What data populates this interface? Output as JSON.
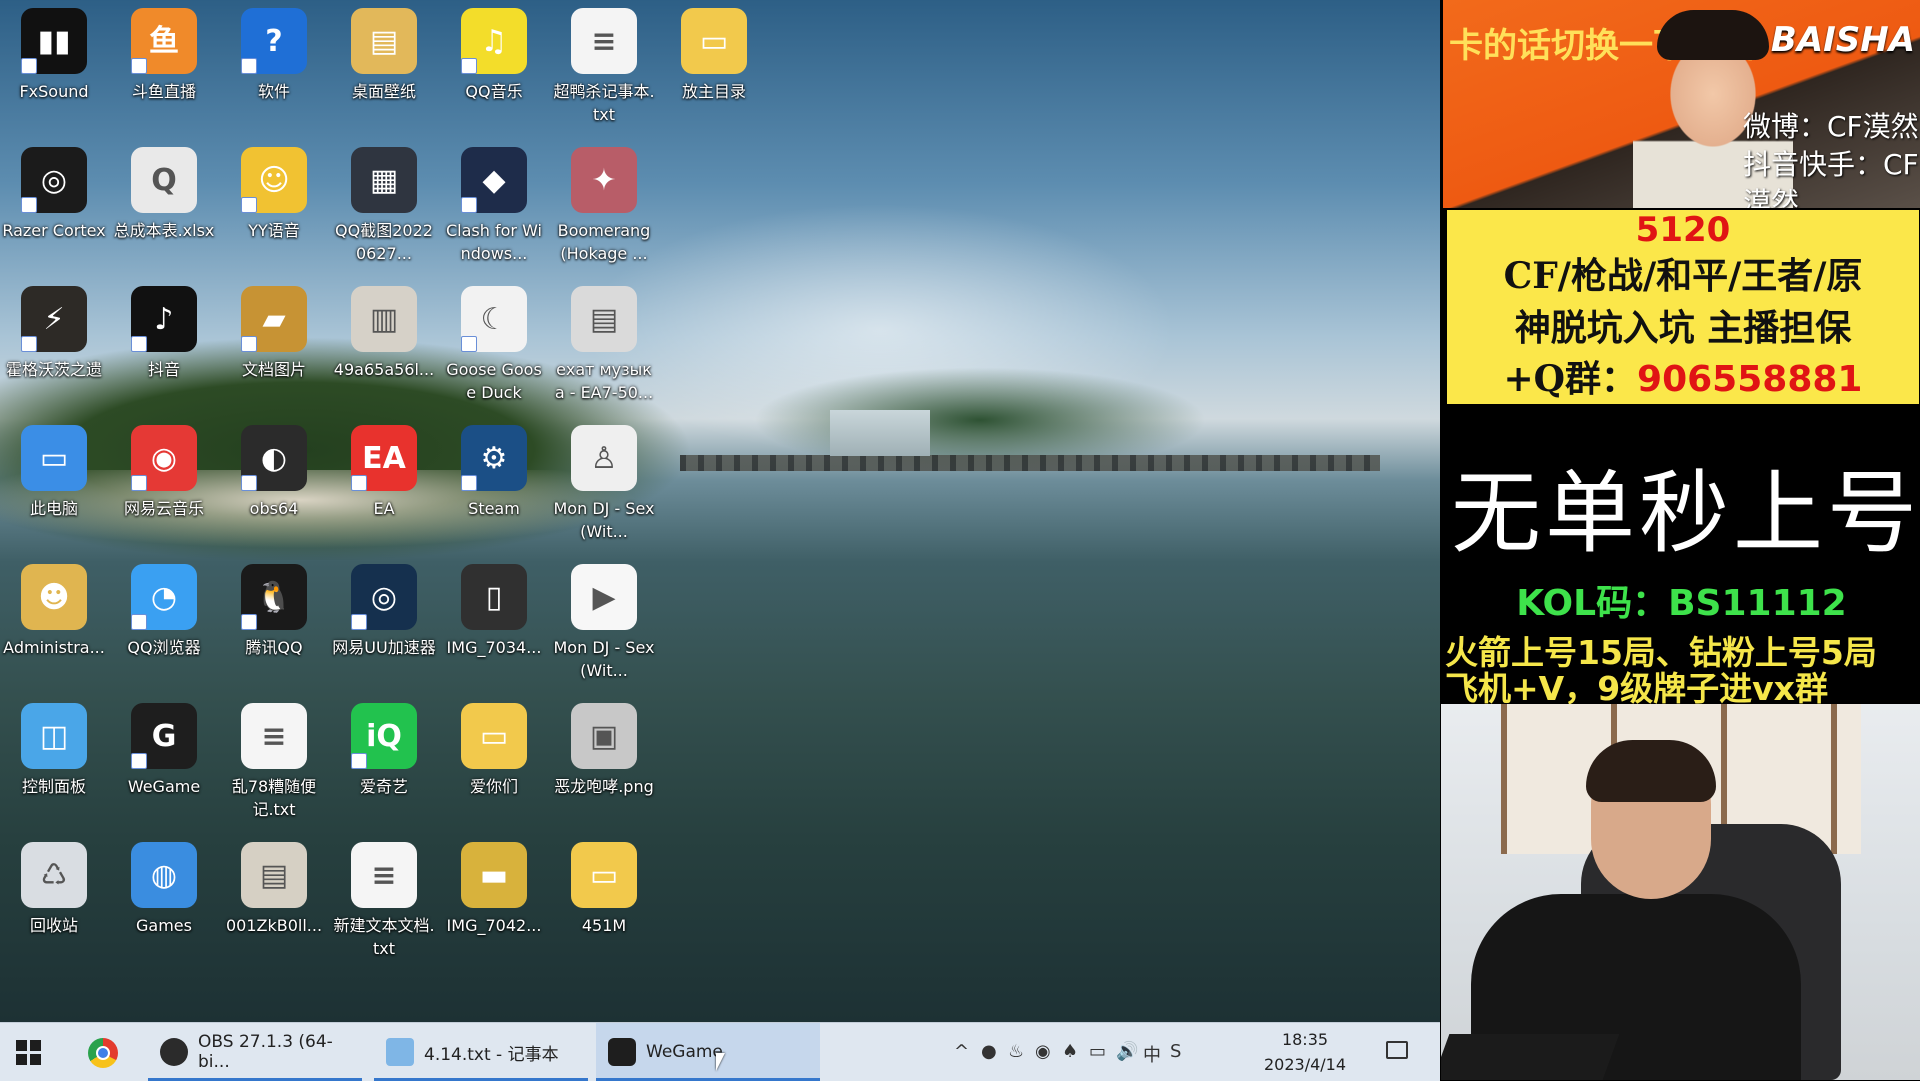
{
  "desktop": {
    "icons": [
      {
        "label": "FxSound",
        "color": "#111111",
        "glyph": "▮▮",
        "shortcut": true,
        "col": 0,
        "row": 0
      },
      {
        "label": "斗鱼直播",
        "color": "#f08a2a",
        "glyph": "鱼",
        "shortcut": true,
        "col": 1,
        "row": 0
      },
      {
        "label": "软件",
        "color": "#1f6fd6",
        "glyph": "?",
        "shortcut": true,
        "col": 2,
        "row": 0
      },
      {
        "label": "桌面壁纸",
        "color": "#e2b85a",
        "glyph": "▤",
        "shortcut": false,
        "col": 3,
        "row": 0
      },
      {
        "label": "QQ音乐",
        "color": "#f3dd2a",
        "glyph": "♫",
        "shortcut": true,
        "col": 4,
        "row": 0
      },
      {
        "label": "超鸭杀记事本.txt",
        "color": "#f4f4f4",
        "glyph": "≡",
        "shortcut": false,
        "col": 5,
        "row": 0
      },
      {
        "label": "放主目录",
        "color": "#f2c94c",
        "glyph": "▭",
        "shortcut": false,
        "col": 6,
        "row": 0
      },
      {
        "label": "Razer Cortex",
        "color": "#1b1b1b",
        "glyph": "◎",
        "shortcut": true,
        "col": 0,
        "row": 1
      },
      {
        "label": "总成本表.xlsx",
        "color": "#e9e9e9",
        "glyph": "Q",
        "shortcut": false,
        "col": 1,
        "row": 1
      },
      {
        "label": "YY语音",
        "color": "#f1c232",
        "glyph": "☺",
        "shortcut": true,
        "col": 2,
        "row": 1
      },
      {
        "label": "QQ截图20220627...",
        "color": "#2f3540",
        "glyph": "▦",
        "shortcut": false,
        "col": 3,
        "row": 1
      },
      {
        "label": "Clash for Windows...",
        "color": "#1e2c4a",
        "glyph": "◆",
        "shortcut": true,
        "col": 4,
        "row": 1
      },
      {
        "label": "Boomerang (Hokage ...",
        "color": "#b85d68",
        "glyph": "✦",
        "shortcut": false,
        "col": 5,
        "row": 1
      },
      {
        "label": "霍格沃茨之遗",
        "color": "#2d2a26",
        "glyph": "⚡",
        "shortcut": true,
        "col": 0,
        "row": 2
      },
      {
        "label": "抖音",
        "color": "#111111",
        "glyph": "♪",
        "shortcut": true,
        "col": 1,
        "row": 2
      },
      {
        "label": "文档图片",
        "color": "#c79334",
        "glyph": "▰",
        "shortcut": true,
        "col": 2,
        "row": 2
      },
      {
        "label": "49a65a56l...",
        "color": "#d6d1c8",
        "glyph": "▥",
        "shortcut": false,
        "col": 3,
        "row": 2
      },
      {
        "label": "Goose Goose Duck",
        "color": "#f2f2f2",
        "glyph": "☾",
        "shortcut": true,
        "col": 4,
        "row": 2
      },
      {
        "label": "ехат музык а - EA7-50...",
        "color": "#dadada",
        "glyph": "▤",
        "shortcut": false,
        "col": 5,
        "row": 2
      },
      {
        "label": "此电脑",
        "color": "#3b8ee6",
        "glyph": "▭",
        "shortcut": false,
        "col": 0,
        "row": 3
      },
      {
        "label": "网易云音乐",
        "color": "#e53935",
        "glyph": "◉",
        "shortcut": true,
        "col": 1,
        "row": 3
      },
      {
        "label": "obs64",
        "color": "#2b2b2b",
        "glyph": "◐",
        "shortcut": true,
        "col": 2,
        "row": 3
      },
      {
        "label": "EA",
        "color": "#e8322d",
        "glyph": "EA",
        "shortcut": true,
        "col": 3,
        "row": 3
      },
      {
        "label": "Steam",
        "color": "#1b4f86",
        "glyph": "⚙",
        "shortcut": true,
        "col": 4,
        "row": 3
      },
      {
        "label": "Mon DJ - Sex (Wit...",
        "color": "#efefef",
        "glyph": "♙",
        "shortcut": false,
        "col": 5,
        "row": 3
      },
      {
        "label": "Administra...",
        "color": "#e0b550",
        "glyph": "☻",
        "shortcut": false,
        "col": 0,
        "row": 4
      },
      {
        "label": "QQ浏览器",
        "color": "#3aa0f2",
        "glyph": "◔",
        "shortcut": true,
        "col": 1,
        "row": 4
      },
      {
        "label": "腾讯QQ",
        "color": "#1a1a1a",
        "glyph": "🐧",
        "shortcut": true,
        "col": 2,
        "row": 4
      },
      {
        "label": "网易UU加速器",
        "color": "#15304e",
        "glyph": "◎",
        "shortcut": true,
        "col": 3,
        "row": 4
      },
      {
        "label": "IMG_7034...",
        "color": "#303030",
        "glyph": "▯",
        "shortcut": false,
        "col": 4,
        "row": 4
      },
      {
        "label": "Mon DJ - Sex (Wit...",
        "color": "#f7f7f7",
        "glyph": "▶",
        "shortcut": false,
        "col": 5,
        "row": 4
      },
      {
        "label": "控制面板",
        "color": "#4aa6e8",
        "glyph": "◫",
        "shortcut": false,
        "col": 0,
        "row": 5
      },
      {
        "label": "WeGame",
        "color": "#1e1e1e",
        "glyph": "G",
        "shortcut": true,
        "col": 1,
        "row": 5
      },
      {
        "label": "乱78糟随便记.txt",
        "color": "#f5f5f5",
        "glyph": "≡",
        "shortcut": false,
        "col": 2,
        "row": 5
      },
      {
        "label": "爱奇艺",
        "color": "#22c24e",
        "glyph": "iQ",
        "shortcut": true,
        "col": 3,
        "row": 5
      },
      {
        "label": "爱你们",
        "color": "#f2c94c",
        "glyph": "▭",
        "shortcut": false,
        "col": 4,
        "row": 5
      },
      {
        "label": "恶龙咆哮.png",
        "color": "#c8c8c8",
        "glyph": "▣",
        "shortcut": false,
        "col": 5,
        "row": 5
      },
      {
        "label": "回收站",
        "color": "#d9dde2",
        "glyph": "♺",
        "shortcut": false,
        "col": 0,
        "row": 6
      },
      {
        "label": "Games",
        "color": "#3a8de0",
        "glyph": "◍",
        "shortcut": false,
        "col": 1,
        "row": 6
      },
      {
        "label": "001ZkB0ll...",
        "color": "#d6d0c4",
        "glyph": "▤",
        "shortcut": false,
        "col": 2,
        "row": 6
      },
      {
        "label": "新建文本文档.txt",
        "color": "#f5f5f5",
        "glyph": "≡",
        "shortcut": false,
        "col": 3,
        "row": 6
      },
      {
        "label": "IMG_7042...",
        "color": "#d8b23c",
        "glyph": "▬",
        "shortcut": false,
        "col": 4,
        "row": 6
      },
      {
        "label": "451M",
        "color": "#f2c94c",
        "glyph": "▭",
        "shortcut": false,
        "col": 5,
        "row": 6
      }
    ]
  },
  "taskbar": {
    "apps": [
      {
        "label": "OBS 27.1.3 (64-bi...",
        "icon_color": "#2b2b2b",
        "icon": "obs-icon"
      },
      {
        "label": "4.14.txt - 记事本",
        "icon_color": "#7fb6e6",
        "icon": "notepad-icon"
      },
      {
        "label": "WeGame",
        "icon_color": "#1e1e1e",
        "icon": "wegame-icon"
      }
    ],
    "tray": [
      "^",
      "●",
      "♨",
      "◉",
      "♠",
      "▭",
      "🔊",
      "中",
      "S"
    ],
    "time": "18:35",
    "date": "2023/4/14"
  },
  "overlay": {
    "banner": {
      "notice": "卡的话切换一下线路",
      "brand": "BAISHA",
      "weibo": "微博：CF漠然",
      "douyin": "抖音快手：CF漠然"
    },
    "promo": {
      "number": "5120",
      "line1": "CF/枪战/和平/王者/原",
      "line2": "神脱坑入坑 主播担保",
      "qq_prefix": "+Q群：",
      "qq_number": "906558881"
    },
    "black": {
      "big": "无单秒上号",
      "kol": "KOL码：BS11112",
      "rule1": "火箭上号15局、钻粉上号5局",
      "rule2": "飞机+V，9级牌子进vx群"
    }
  }
}
